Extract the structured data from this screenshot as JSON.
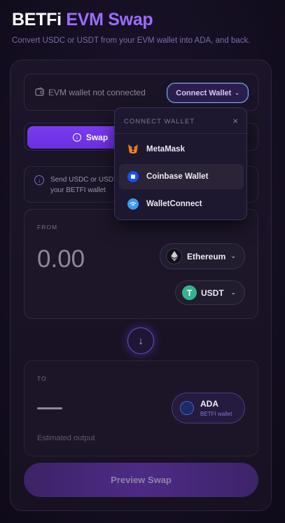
{
  "header": {
    "brand": "BETFi",
    "title": "EVM Swap",
    "subtitle": "Convert USDC or USDT from your EVM wallet into ADA, and back."
  },
  "wallet": {
    "status": "EVM wallet not connected",
    "connect_label": "Connect Wallet"
  },
  "mode": {
    "swap_label": "Swap"
  },
  "info": {
    "text_line1": "Send USDC or USDT",
    "text_line2": "your BETFI wallet"
  },
  "from": {
    "label": "FROM",
    "amount": "0.00",
    "chain": "Ethereum",
    "token": "USDT"
  },
  "to": {
    "label": "TO",
    "token": "ADA",
    "token_sub": "BETFI wallet",
    "estimated": "Estimated output"
  },
  "actions": {
    "preview_label": "Preview Swap"
  },
  "dropdown": {
    "heading": "CONNECT WALLET",
    "close_symbol": "×",
    "items": [
      {
        "label": "MetaMask",
        "icon": "metamask-icon"
      },
      {
        "label": "Coinbase Wallet",
        "icon": "coinbase-icon"
      },
      {
        "label": "WalletConnect",
        "icon": "walletconnect-icon"
      }
    ]
  },
  "colors": {
    "accent": "#9b6dff",
    "swap_button": "#7a3cf0",
    "background": "#150f22"
  }
}
